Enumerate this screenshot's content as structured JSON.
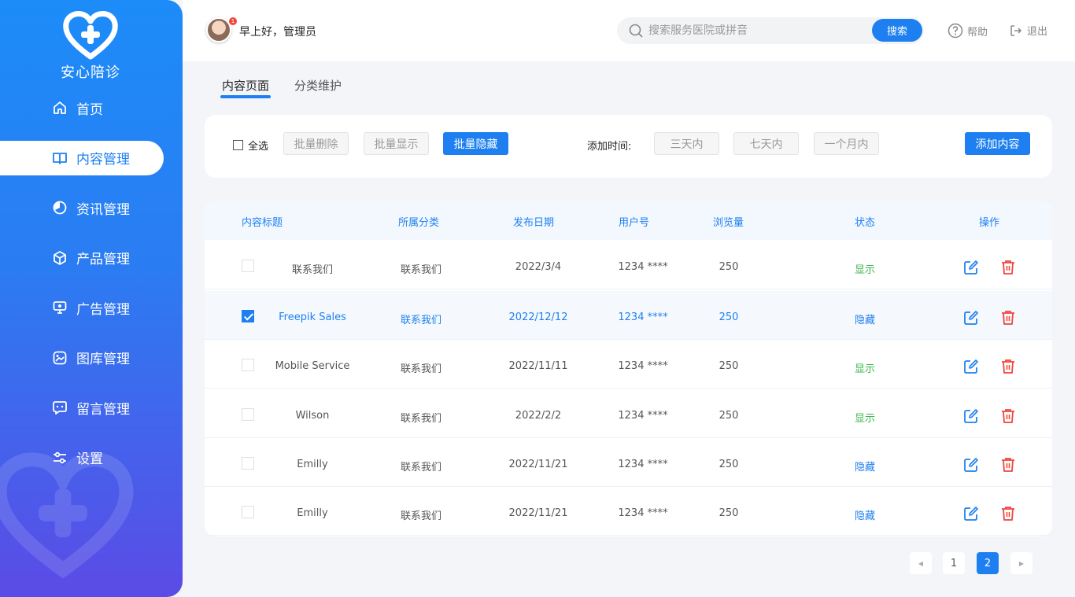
{
  "brand": {
    "name": "安心陪诊"
  },
  "sidebar": {
    "items": [
      {
        "label": "首页",
        "icon": "home-icon"
      },
      {
        "label": "内容管理",
        "icon": "book-icon",
        "active": true
      },
      {
        "label": "资讯管理",
        "icon": "pie-icon"
      },
      {
        "label": "产品管理",
        "icon": "box-icon"
      },
      {
        "label": "广告管理",
        "icon": "monitor-icon"
      },
      {
        "label": "图库管理",
        "icon": "gallery-icon"
      },
      {
        "label": "留言管理",
        "icon": "message-icon"
      },
      {
        "label": "设置",
        "icon": "settings-icon"
      }
    ]
  },
  "header": {
    "greeting": "早上好，管理员",
    "avatar_badge": "1",
    "search_placeholder": "搜索服务医院或拼音",
    "search_button": "搜索",
    "help": "帮助",
    "logout": "退出"
  },
  "tabs": [
    {
      "label": "内容页面",
      "active": true
    },
    {
      "label": "分类维护",
      "active": false
    }
  ],
  "toolbar": {
    "select_all": "全选",
    "batch_delete": "批量删除",
    "batch_show": "批量显示",
    "batch_hide": "批量隐藏",
    "time_label": "添加时间:",
    "time_3d": "三天内",
    "time_7d": "七天内",
    "time_1m": "一个月内",
    "add_content": "添加内容"
  },
  "table": {
    "columns": [
      "内容标题",
      "所属分类",
      "发布日期",
      "用户号",
      "浏览量",
      "状态",
      "操作"
    ],
    "rows": [
      {
        "title": "联系我们",
        "category": "联系我们",
        "date": "2022/3/4",
        "user": "1234 ****",
        "views": "250",
        "status": "显示",
        "checked": false
      },
      {
        "title": "Freepik Sales",
        "category": "联系我们",
        "date": "2022/12/12",
        "user": "1234 ****",
        "views": "250",
        "status": "隐藏",
        "checked": true
      },
      {
        "title": "Mobile Service",
        "category": "联系我们",
        "date": "2022/11/11",
        "user": "1234 ****",
        "views": "250",
        "status": "显示",
        "checked": false
      },
      {
        "title": "Wilson",
        "category": "联系我们",
        "date": "2022/2/2",
        "user": "1234 ****",
        "views": "250",
        "status": "显示",
        "checked": false
      },
      {
        "title": "Emilly",
        "category": "联系我们",
        "date": "2022/11/21",
        "user": "1234 ****",
        "views": "250",
        "status": "隐藏",
        "checked": false
      },
      {
        "title": "Emilly",
        "category": "联系我们",
        "date": "2022/11/21",
        "user": "1234 ****",
        "views": "250",
        "status": "隐藏",
        "checked": false
      }
    ]
  },
  "pagination": {
    "pages": [
      "1",
      "2"
    ],
    "current": "2"
  },
  "colors": {
    "primary": "#1e80f0",
    "show": "#3bb54a",
    "delete": "#f0463b"
  }
}
